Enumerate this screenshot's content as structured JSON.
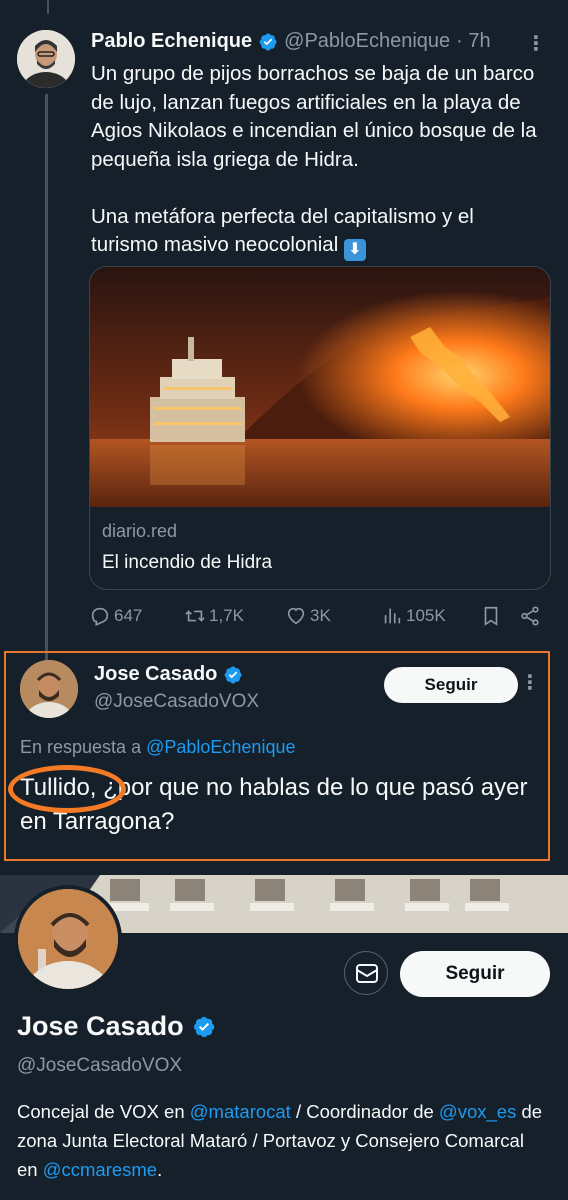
{
  "tweet": {
    "author_name": "Pablo Echenique",
    "author_handle": "@PabloEchenique",
    "time": "· 7h",
    "paragraph1": "Un grupo de pijos borrachos se baja de un barco de lujo, lanzan fuegos artificiales en la playa de Agios Nikolaos e incendian el único bosque de la pequeña isla griega de Hidra.",
    "paragraph2": "Una metáfora perfecta del capitalismo y el turismo masivo neocolonial",
    "emoji": "⬇",
    "card": {
      "domain": "diario.red",
      "title": "El incendio de Hidra"
    },
    "stats": {
      "replies": "647",
      "retweets": "1,7K",
      "likes": "3K",
      "views": "105K"
    }
  },
  "reply": {
    "author_name": "Jose Casado",
    "author_handle": "@JoseCasadoVOX",
    "follow_label": "Seguir",
    "in_reply_prefix": "En respuesta a ",
    "in_reply_mention": "@PabloEchenique",
    "text": "Tullido, ¿por que no hablas de lo que pasó ayer en Tarragona?"
  },
  "profile": {
    "name": "Jose Casado",
    "handle": "@JoseCasadoVOX",
    "follow_label": "Seguir",
    "bio_1": "Concejal de VOX en ",
    "bio_link1": "@matarocat",
    "bio_2": " / Coordinador de ",
    "bio_link2": "@vox_es",
    "bio_3": " de zona Junta Electoral Mataró / Portavoz y Consejero Comarcal en ",
    "bio_link3": "@ccmaresme",
    "bio_4": "."
  },
  "colors": {
    "background": "#15202b",
    "accent": "#1d9bf0",
    "highlight_box": "#e8762b",
    "highlight_circle": "#f47a23"
  },
  "icons": [
    "verified-badge-icon",
    "reply-icon",
    "retweet-icon",
    "like-icon",
    "views-icon",
    "bookmark-icon",
    "share-icon",
    "more-icon",
    "message-icon"
  ]
}
